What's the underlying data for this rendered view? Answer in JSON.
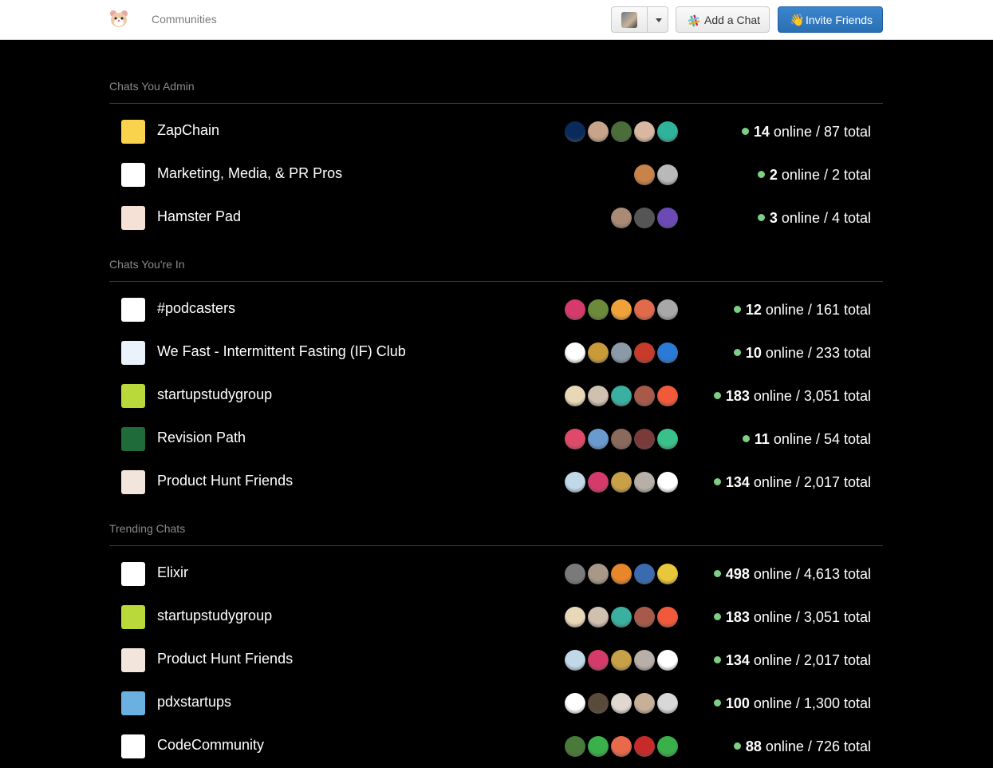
{
  "nav": {
    "title": "Communities",
    "add_chat_label": "Add a Chat",
    "invite_label": "Invite Friends",
    "invite_emoji": "👋"
  },
  "sections": [
    {
      "heading": "Chats You Admin",
      "chats": [
        {
          "name": "ZapChain",
          "icon": "lightning-bolt-icon",
          "icon_bg": "#f9d34b",
          "online": "14",
          "total_text": "online / 87 total",
          "avatars": [
            "#0a2a5c",
            "#c8a48a",
            "#4a6d3a",
            "#d9b7a0",
            "#2fb39b"
          ]
        },
        {
          "name": "Marketing, Media, & PR Pros",
          "icon": "megaphone-icon",
          "icon_bg": "#ffffff",
          "online": "2",
          "total_text": "online / 2 total",
          "avatars": [
            "#c8824a",
            "#b9b9b9"
          ]
        },
        {
          "name": "Hamster Pad",
          "icon": "hamster-icon",
          "icon_bg": "#f6e1d6",
          "online": "3",
          "total_text": "online / 4 total",
          "avatars": [
            "#a88a75",
            "#555555",
            "#6b4ab8"
          ]
        }
      ]
    },
    {
      "heading": "Chats You're In",
      "chats": [
        {
          "name": "#podcasters",
          "icon": "microphone-icon",
          "icon_bg": "#ffffff",
          "online": "12",
          "total_text": "online / 161 total",
          "avatars": [
            "#d63a6b",
            "#6b8a3a",
            "#f0a23a",
            "#e06a4a",
            "#a8a8a8"
          ]
        },
        {
          "name": "We Fast - Intermittent Fasting (IF) Club",
          "icon": "water-drop-icon",
          "icon_bg": "#eaf2fb",
          "online": "10",
          "total_text": "online / 233 total",
          "avatars": [
            "#ffffff",
            "#c89a3a",
            "#8a9aa8",
            "#c83a2a",
            "#2a7ad6"
          ]
        },
        {
          "name": "startupstudygroup",
          "icon": "ssg-bubble-icon",
          "icon_bg": "#b9d93a",
          "online": "183",
          "total_text": "online / 3,051 total",
          "avatars": [
            "#e8d8b8",
            "#d0c0b0",
            "#3ab0a0",
            "#a85a4a",
            "#f05a3a"
          ]
        },
        {
          "name": "Revision Path",
          "icon": "revision-path-icon",
          "icon_bg": "#1f6b3a",
          "online": "11",
          "total_text": "online / 54 total",
          "avatars": [
            "#e04a6a",
            "#6a9ad0",
            "#8a6a5a",
            "#7a3a3a",
            "#3ac08a"
          ]
        },
        {
          "name": "Product Hunt Friends",
          "icon": "kitty-icon",
          "icon_bg": "#f2e6dc",
          "online": "134",
          "total_text": "online / 2,017 total",
          "avatars": [
            "#c0d8e8",
            "#d63a6b",
            "#c8a048",
            "#b8b0a8",
            "#ffffff"
          ]
        }
      ]
    },
    {
      "heading": "Trending Chats",
      "chats": [
        {
          "name": "Elixir",
          "icon": "elixir-drop-icon",
          "icon_bg": "#ffffff",
          "online": "498",
          "total_text": "online / 4,613 total",
          "avatars": [
            "#7a7a7a",
            "#a89888",
            "#e8862a",
            "#3a6ab0",
            "#e8c83a"
          ]
        },
        {
          "name": "startupstudygroup",
          "icon": "ssg-bubble-icon",
          "icon_bg": "#b9d93a",
          "online": "183",
          "total_text": "online / 3,051 total",
          "avatars": [
            "#e8d8b8",
            "#d0c0b0",
            "#3ab0a0",
            "#a85a4a",
            "#f05a3a"
          ]
        },
        {
          "name": "Product Hunt Friends",
          "icon": "kitty-icon",
          "icon_bg": "#f2e6dc",
          "online": "134",
          "total_text": "online / 2,017 total",
          "avatars": [
            "#c0d8e8",
            "#d63a6b",
            "#c8a048",
            "#b8b0a8",
            "#ffffff"
          ]
        },
        {
          "name": "pdxstartups",
          "icon": "rose-icon",
          "icon_bg": "#6ab0e0",
          "online": "100",
          "total_text": "online / 1,300 total",
          "avatars": [
            "#ffffff",
            "#5a4a3a",
            "#e0d8d0",
            "#c8b098",
            "#d8d8d8"
          ]
        },
        {
          "name": "CodeCommunity",
          "icon": "emc-code-icon",
          "icon_bg": "#ffffff",
          "online": "88",
          "total_text": "online / 726 total",
          "avatars": [
            "#4a7a3a",
            "#3ab04a",
            "#e86a4a",
            "#c82a2a",
            "#3ab04a"
          ]
        }
      ]
    }
  ]
}
